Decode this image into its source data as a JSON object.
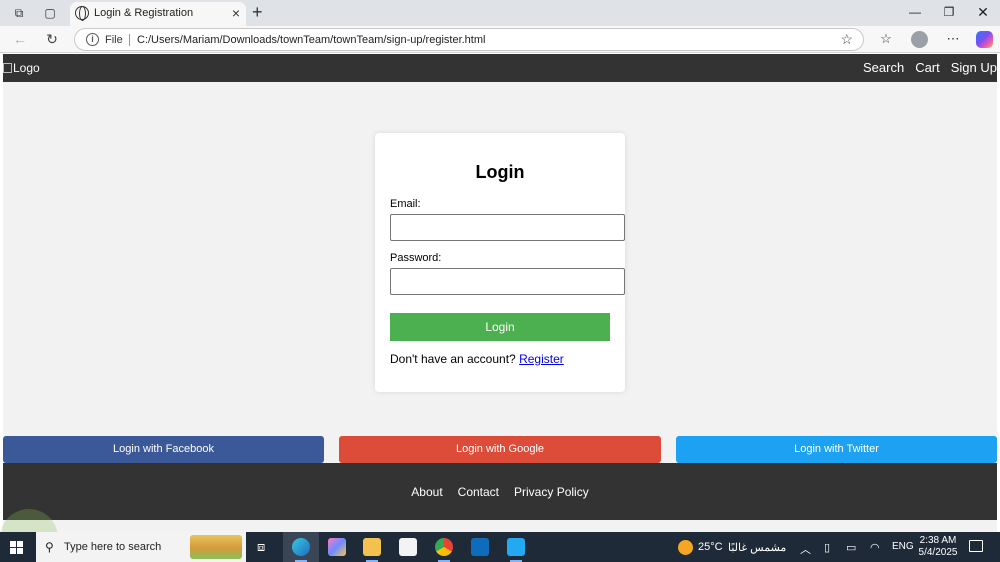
{
  "browser": {
    "tab_title": "Login & Registration",
    "address_scheme": "File",
    "url": "C:/Users/Mariam/Downloads/townTeam/townTeam/sign-up/register.html"
  },
  "header": {
    "logo_alt": "Logo",
    "nav": [
      "Search",
      "Cart",
      "Sign Up"
    ]
  },
  "login_form": {
    "title": "Login",
    "email_label": "Email:",
    "email_value": "",
    "password_label": "Password:",
    "password_value": "",
    "submit_label": "Login",
    "no_account_text": "Don't have an account?",
    "register_link": "Register"
  },
  "social": {
    "facebook": "Login with Facebook",
    "google": "Login with Google",
    "twitter": "Login with Twitter"
  },
  "footer": {
    "links": [
      "About",
      "Contact",
      "Privacy Policy"
    ]
  },
  "colors": {
    "header_bg": "#333333",
    "login_button": "#4caf50",
    "facebook": "#3b5998",
    "google": "#dd4b39",
    "twitter": "#1da1f2",
    "link": "#0000ee"
  },
  "taskbar": {
    "search_placeholder": "Type here to search",
    "weather_temp": "25°C",
    "weather_text": "مشمس غالبًا",
    "language": "ENG",
    "time": "2:38 AM",
    "date": "5/4/2025"
  }
}
